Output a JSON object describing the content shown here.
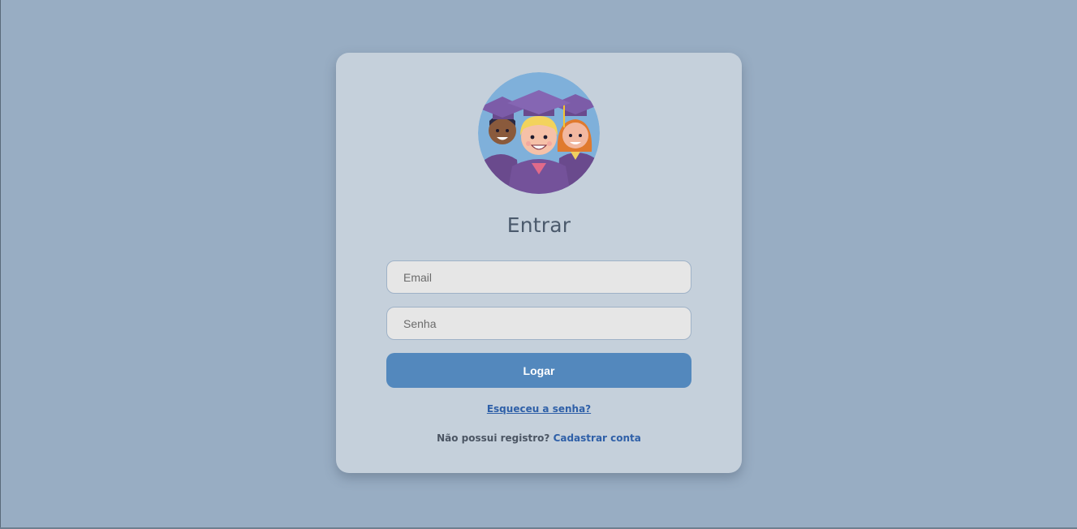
{
  "page": {
    "background_color": "#98adc3",
    "card_color": "#c5d0db",
    "accent_color": "#5388bd",
    "link_color": "#2f60a8"
  },
  "logo": {
    "icon": "graduates-avatar-icon"
  },
  "login": {
    "title": "Entrar",
    "email_placeholder": "Email",
    "password_placeholder": "Senha",
    "submit_label": "Logar",
    "forgot_label": "Esqueceu a senha?",
    "register_prompt": "Não possui registro?",
    "register_link": "Cadastrar conta"
  }
}
